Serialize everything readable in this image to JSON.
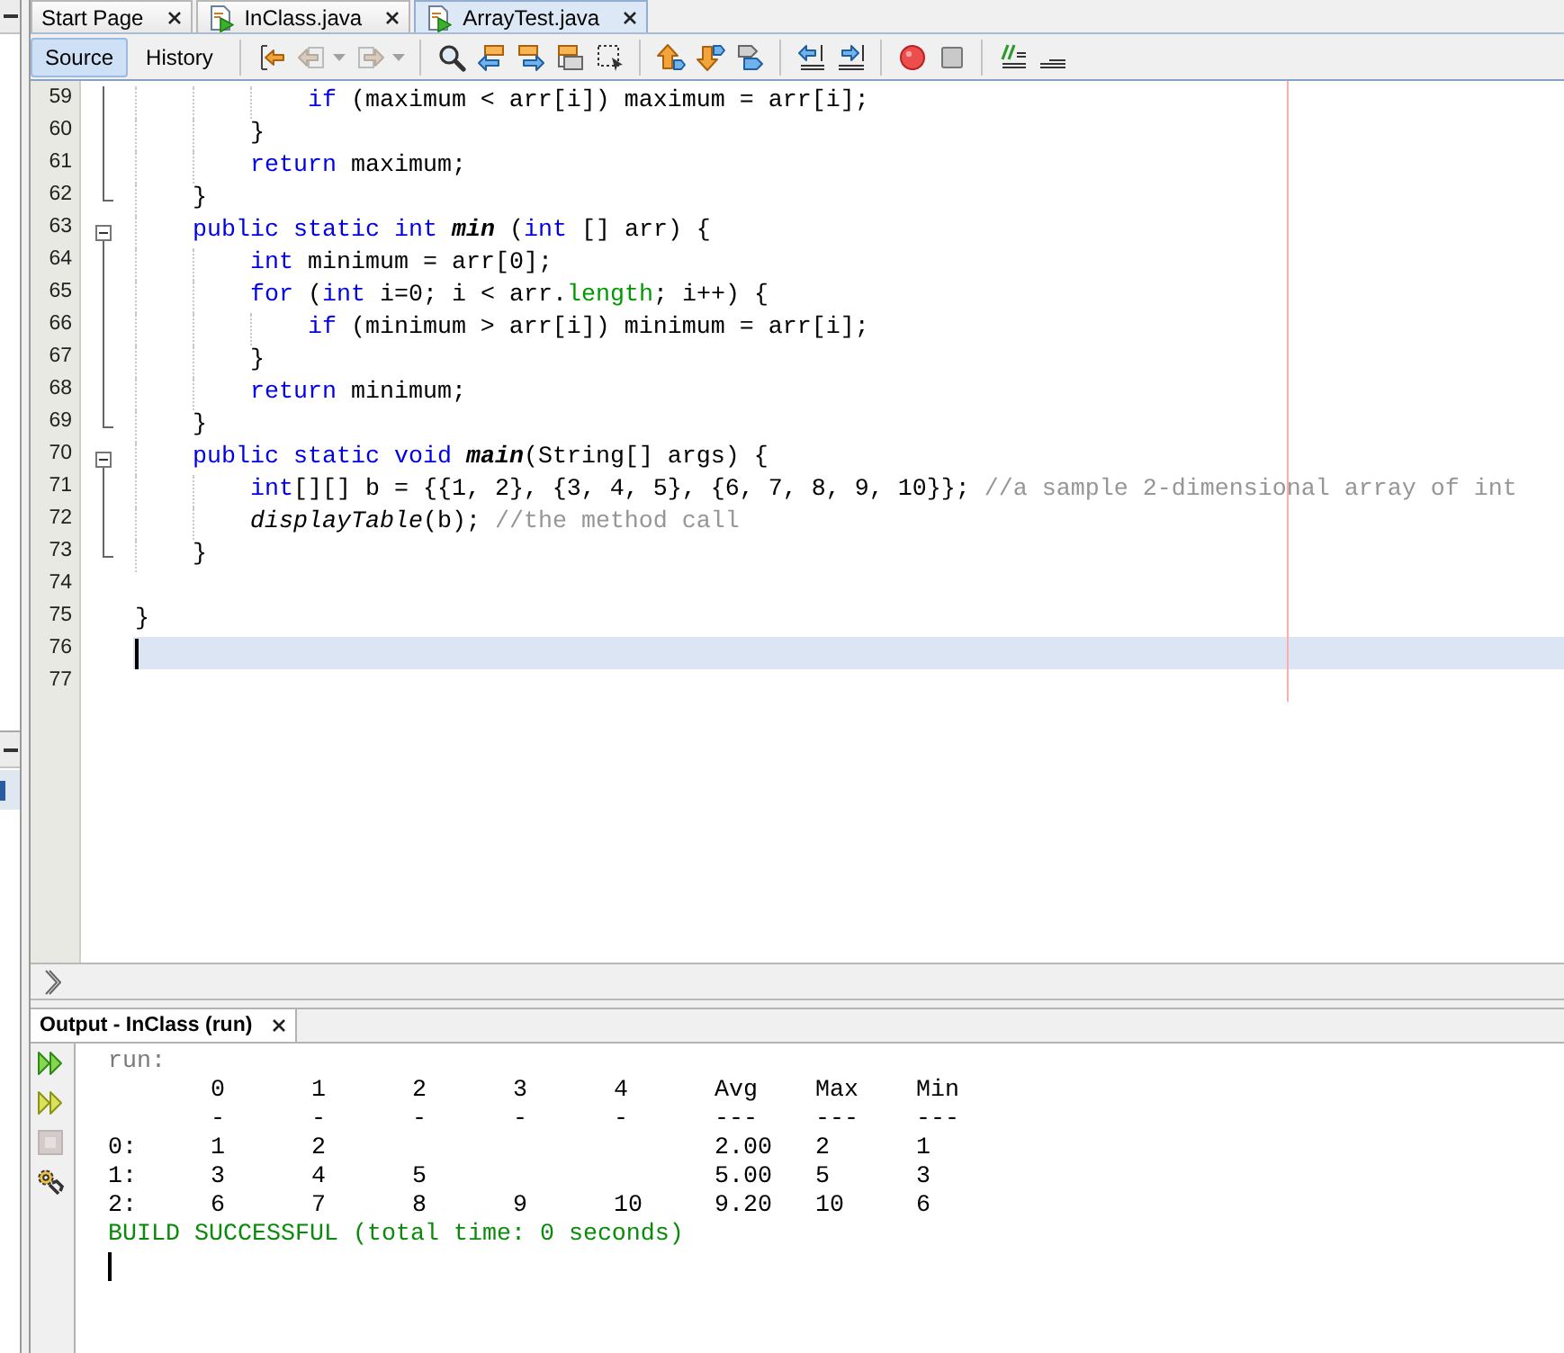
{
  "side_panel": {
    "rows": [
      {
        "selected": true
      }
    ]
  },
  "editor_tabs": [
    {
      "kind": "start_page",
      "label": "Start Page",
      "selected": false
    },
    {
      "kind": "java_file",
      "label": "InClass.java",
      "selected": false
    },
    {
      "kind": "java_file",
      "label": "ArrayTest.java",
      "selected": true
    }
  ],
  "toolbar": {
    "views": [
      {
        "label": "Source",
        "selected": true
      },
      {
        "label": "History",
        "selected": false
      }
    ],
    "tool_groups": [
      [
        {
          "kind": "last_edit",
          "disabled": false
        },
        {
          "kind": "back",
          "disabled": true
        },
        {
          "kind": "forward",
          "disabled": true
        }
      ],
      [
        {
          "kind": "find",
          "disabled": false
        },
        {
          "kind": "find_previous",
          "disabled": false
        },
        {
          "kind": "find_next",
          "disabled": false
        },
        {
          "kind": "toggle_highlight",
          "disabled": false
        },
        {
          "kind": "find_selection",
          "disabled": false
        }
      ],
      [
        {
          "kind": "previous_bookmark",
          "disabled": false
        },
        {
          "kind": "next_bookmark",
          "disabled": false
        },
        {
          "kind": "toggle_bookmark",
          "disabled": false
        }
      ],
      [
        {
          "kind": "shift_left",
          "disabled": false
        },
        {
          "kind": "shift_right",
          "disabled": false
        }
      ],
      [
        {
          "kind": "record_macro",
          "disabled": false
        },
        {
          "kind": "stop_macro",
          "disabled": false
        }
      ],
      [
        {
          "kind": "comment",
          "disabled": false
        },
        {
          "kind": "uncomment",
          "disabled": false
        }
      ]
    ]
  },
  "editor": {
    "lines": [
      {
        "number": "59",
        "kind": "fold_inside",
        "current": false,
        "tokens": [
          {
            "kind": "keyword",
            "text": "            if"
          },
          {
            "kind": "plain",
            "text": " (maximum < arr[i]) maximum = arr[i];"
          }
        ]
      },
      {
        "number": "60",
        "kind": "fold_inside",
        "current": false,
        "tokens": [
          {
            "kind": "plain",
            "text": "        }"
          }
        ]
      },
      {
        "number": "61",
        "kind": "fold_inside",
        "current": false,
        "tokens": [
          {
            "kind": "keyword",
            "text": "        return"
          },
          {
            "kind": "plain",
            "text": " maximum;"
          }
        ]
      },
      {
        "number": "62",
        "kind": "fold_end",
        "current": false,
        "tokens": [
          {
            "kind": "plain",
            "text": "    }"
          }
        ]
      },
      {
        "number": "63",
        "kind": "fold_open",
        "current": false,
        "tokens": [
          {
            "kind": "keyword",
            "text": "    public static int "
          },
          {
            "kind": "static_declaration",
            "text": "min"
          },
          {
            "kind": "plain",
            "text": " ("
          },
          {
            "kind": "keyword",
            "text": "int"
          },
          {
            "kind": "plain",
            "text": " [] arr) {"
          }
        ]
      },
      {
        "number": "64",
        "kind": "fold_inside",
        "current": false,
        "tokens": [
          {
            "kind": "keyword",
            "text": "        int"
          },
          {
            "kind": "plain",
            "text": " minimum = arr[0];"
          }
        ]
      },
      {
        "number": "65",
        "kind": "fold_inside",
        "current": false,
        "tokens": [
          {
            "kind": "keyword",
            "text": "        for"
          },
          {
            "kind": "plain",
            "text": " ("
          },
          {
            "kind": "keyword",
            "text": "int"
          },
          {
            "kind": "plain",
            "text": " i=0; i < arr."
          },
          {
            "kind": "field",
            "text": "length"
          },
          {
            "kind": "plain",
            "text": "; i++) {"
          }
        ]
      },
      {
        "number": "66",
        "kind": "fold_inside",
        "current": false,
        "tokens": [
          {
            "kind": "keyword",
            "text": "            if"
          },
          {
            "kind": "plain",
            "text": " (minimum > arr[i]) minimum = arr[i];"
          }
        ]
      },
      {
        "number": "67",
        "kind": "fold_inside",
        "current": false,
        "tokens": [
          {
            "kind": "plain",
            "text": "        }"
          }
        ]
      },
      {
        "number": "68",
        "kind": "fold_inside",
        "current": false,
        "tokens": [
          {
            "kind": "keyword",
            "text": "        return"
          },
          {
            "kind": "plain",
            "text": " minimum;"
          }
        ]
      },
      {
        "number": "69",
        "kind": "fold_end",
        "current": false,
        "tokens": [
          {
            "kind": "plain",
            "text": "    }"
          }
        ]
      },
      {
        "number": "70",
        "kind": "fold_open",
        "current": false,
        "tokens": [
          {
            "kind": "keyword",
            "text": "    public static void "
          },
          {
            "kind": "static_declaration",
            "text": "main"
          },
          {
            "kind": "plain",
            "text": "(String[] args) {"
          }
        ]
      },
      {
        "number": "71",
        "kind": "fold_inside",
        "current": false,
        "tokens": [
          {
            "kind": "keyword",
            "text": "        int"
          },
          {
            "kind": "plain",
            "text": "[][] b = {{1, 2}, {3, 4, 5}, {6, 7, 8, 9, 10}}; "
          },
          {
            "kind": "comment",
            "text": "//a sample 2-dimensional array of int"
          }
        ]
      },
      {
        "number": "72",
        "kind": "fold_inside",
        "current": false,
        "tokens": [
          {
            "kind": "static_call",
            "text": "        displayTable"
          },
          {
            "kind": "plain",
            "text": "(b); "
          },
          {
            "kind": "comment",
            "text": "//the method call"
          }
        ]
      },
      {
        "number": "73",
        "kind": "fold_end",
        "current": false,
        "tokens": [
          {
            "kind": "plain",
            "text": "    }"
          }
        ]
      },
      {
        "number": "74",
        "kind": "plain",
        "current": false
      },
      {
        "number": "75",
        "kind": "plain",
        "current": false,
        "tokens": [
          {
            "kind": "plain",
            "text": "}"
          }
        ]
      },
      {
        "number": "76",
        "kind": "plain",
        "current": true
      },
      {
        "number": "77",
        "kind": "plain",
        "current": false
      }
    ]
  },
  "output": {
    "tab": {
      "label": "Output - InClass (run)",
      "selected": true
    },
    "actions": [
      {
        "kind": "rerun",
        "disabled": false
      },
      {
        "kind": "rerun_with_options",
        "disabled": false
      },
      {
        "kind": "stop",
        "disabled": true
      },
      {
        "kind": "settings",
        "disabled": false
      }
    ],
    "log_start": "run:",
    "table": {
      "columns": [
        "0",
        "1",
        "2",
        "3",
        "4",
        "Avg",
        "Max",
        "Min"
      ],
      "rules": [
        "-",
        "-",
        "-",
        "-",
        "-",
        "---",
        "---",
        "---"
      ],
      "rows": [
        {
          "label": "0:",
          "cells": [
            "1",
            "2",
            null,
            null,
            null,
            "2.00",
            "2",
            "1"
          ]
        },
        {
          "label": "1:",
          "cells": [
            "3",
            "4",
            "5",
            null,
            null,
            "5.00",
            "5",
            "3"
          ]
        },
        {
          "label": "2:",
          "cells": [
            "6",
            "7",
            "8",
            "9",
            "10",
            "9.20",
            "10",
            "6"
          ]
        }
      ]
    },
    "result": "BUILD SUCCESSFUL (total time: 0 seconds)",
    "caret": true
  }
}
